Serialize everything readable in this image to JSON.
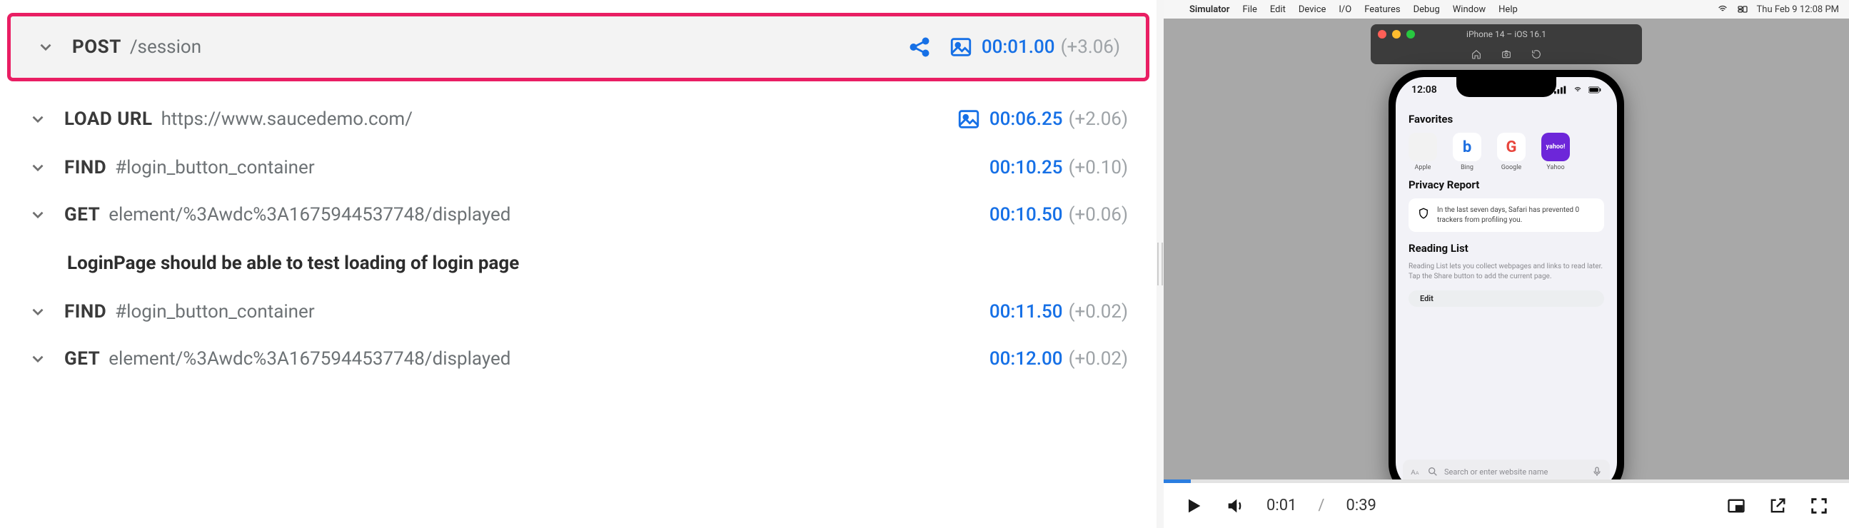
{
  "steps": [
    {
      "verb": "POST",
      "path": "/session",
      "time": "00:01.00",
      "delta": "(+3.06)",
      "share": true,
      "screenshot": true,
      "highlight": true
    },
    {
      "verb": "LOAD URL",
      "path": "https://www.saucedemo.com/",
      "time": "00:06.25",
      "delta": "(+2.06)",
      "share": false,
      "screenshot": true,
      "highlight": false
    },
    {
      "verb": "FIND",
      "path": "#login_button_container",
      "time": "00:10.25",
      "delta": "(+0.10)",
      "share": false,
      "screenshot": false,
      "highlight": false
    },
    {
      "verb": "GET",
      "path": "element/%3Awdc%3A1675944537748/displayed",
      "time": "00:10.50",
      "delta": "(+0.06)",
      "share": false,
      "screenshot": false,
      "highlight": false
    }
  ],
  "section_label": "LoginPage should be able to test loading of login page",
  "steps_after": [
    {
      "verb": "FIND",
      "path": "#login_button_container",
      "time": "00:11.50",
      "delta": "(+0.02)"
    },
    {
      "verb": "GET",
      "path": "element/%3Awdc%3A1675944537748/displayed",
      "time": "00:12.00",
      "delta": "(+0.02)"
    }
  ],
  "mac_menu": {
    "app": "Simulator",
    "items": [
      "File",
      "Edit",
      "Device",
      "I/O",
      "Features",
      "Debug",
      "Window",
      "Help"
    ],
    "clock": "Thu Feb 9  12:08 PM"
  },
  "sim": {
    "title": "iPhone 14 – iOS 16.1"
  },
  "phone": {
    "clock": "12:08",
    "favorites_title": "Favorites",
    "favorites": [
      {
        "label": "Apple",
        "bg": "#f2f2f2",
        "glyph": "",
        "fg": "#222"
      },
      {
        "label": "Bing",
        "bg": "#ffffff",
        "glyph": "b",
        "fg": "#1e6fe0"
      },
      {
        "label": "Google",
        "bg": "#ffffff",
        "glyph": "G",
        "fg": "#e8453c"
      },
      {
        "label": "Yahoo",
        "bg": "#6d26d9",
        "glyph": "yahoo!",
        "fg": "#fff"
      }
    ],
    "privacy_title": "Privacy Report",
    "privacy_text": "In the last seven days, Safari has prevented 0 trackers from profiling you.",
    "reading_title": "Reading List",
    "reading_text": "Reading List lets you collect webpages and links to read later. Tap the Share button to add the current page.",
    "edit_label": "Edit",
    "search_placeholder": "Search or enter website name"
  },
  "video": {
    "current": "0:01",
    "sep": "/",
    "total": "0:39"
  }
}
